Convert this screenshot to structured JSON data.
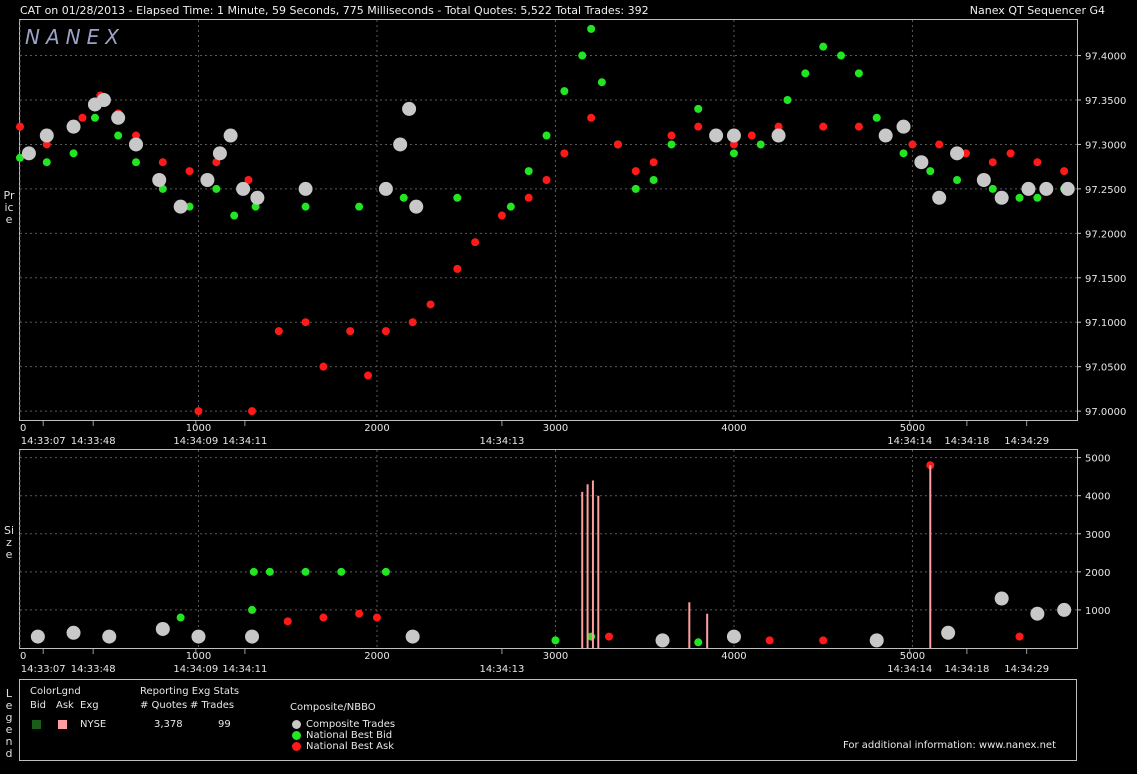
{
  "header": {
    "left": "CAT on 01/28/2013  -  Elapsed Time: 1 Minute, 59 Seconds, 775 Milliseconds  -  Total Quotes: 5,522  Total Trades: 392",
    "right": "Nanex QT Sequencer G4",
    "logo": "NANEX"
  },
  "side_labels": {
    "price": "Price",
    "size": "Size",
    "legend": "Legend"
  },
  "legend": {
    "colorlgnd_title": "ColorLgnd",
    "bid_label": "Bid",
    "ask_label": "Ask",
    "exg_label": "Exg",
    "exchange": "NYSE",
    "bid_color": "#1a5c1a",
    "ask_color": "#ff9e9e",
    "stats_title": "Reporting Exg Stats",
    "quotes_label": "# Quotes",
    "trades_label": "# Trades",
    "quotes_value": "3,378",
    "trades_value": "99",
    "composite_title": "Composite/NBBO",
    "items": [
      {
        "label": "Composite Trades",
        "color": "#c8c8c8"
      },
      {
        "label": "National Best Bid",
        "color": "#22e622"
      },
      {
        "label": "National Best Ask",
        "color": "#ff1a1a"
      }
    ],
    "footer": "For additional information: www.nanex.net"
  },
  "chart_data": [
    {
      "type": "scatter",
      "ylabel": "Price",
      "xlim": [
        0,
        5922
      ],
      "ylim": [
        96.99,
        97.44
      ],
      "x_ticks": [
        0,
        1000,
        2000,
        3000,
        4000,
        5000
      ],
      "y_ticks": [
        "97.0000",
        "97.0500",
        "97.1000",
        "97.1500",
        "97.2000",
        "97.2500",
        "97.3000",
        "97.3500",
        "97.4000"
      ],
      "time_labels": [
        {
          "x": 130,
          "label": "14:33:07"
        },
        {
          "x": 410,
          "label": "14:33:48"
        },
        {
          "x": 985,
          "label": "14:34:09"
        },
        {
          "x": 1260,
          "label": "14:34:11"
        },
        {
          "x": 2700,
          "label": "14:34:13"
        },
        {
          "x": 4985,
          "label": "14:34:14"
        },
        {
          "x": 5305,
          "label": "14:34:18"
        },
        {
          "x": 5640,
          "label": "14:34:29"
        }
      ],
      "grid": true,
      "series": [
        {
          "name": "National Best Bid",
          "color": "#22e622",
          "points": [
            [
              0,
              97.285
            ],
            [
              150,
              97.28
            ],
            [
              300,
              97.29
            ],
            [
              420,
              97.33
            ],
            [
              550,
              97.31
            ],
            [
              650,
              97.28
            ],
            [
              800,
              97.25
            ],
            [
              950,
              97.23
            ],
            [
              1100,
              97.25
            ],
            [
              1200,
              97.22
            ],
            [
              1320,
              97.23
            ],
            [
              1600,
              97.23
            ],
            [
              1900,
              97.23
            ],
            [
              2150,
              97.24
            ],
            [
              2450,
              97.24
            ],
            [
              2750,
              97.23
            ],
            [
              2850,
              97.27
            ],
            [
              2950,
              97.31
            ],
            [
              3050,
              97.36
            ],
            [
              3150,
              97.4
            ],
            [
              3200,
              97.43
            ],
            [
              3260,
              97.37
            ],
            [
              3350,
              97.3
            ],
            [
              3450,
              97.25
            ],
            [
              3550,
              97.26
            ],
            [
              3650,
              97.3
            ],
            [
              3800,
              97.34
            ],
            [
              3900,
              97.31
            ],
            [
              4000,
              97.29
            ],
            [
              4150,
              97.3
            ],
            [
              4300,
              97.35
            ],
            [
              4400,
              97.38
            ],
            [
              4500,
              97.41
            ],
            [
              4600,
              97.4
            ],
            [
              4700,
              97.38
            ],
            [
              4800,
              97.33
            ],
            [
              4950,
              97.29
            ],
            [
              5100,
              97.27
            ],
            [
              5250,
              97.26
            ],
            [
              5450,
              97.25
            ],
            [
              5600,
              97.24
            ],
            [
              5700,
              97.24
            ],
            [
              5850,
              97.25
            ]
          ]
        },
        {
          "name": "National Best Ask",
          "color": "#ff1a1a",
          "points": [
            [
              0,
              97.32
            ],
            [
              150,
              97.3
            ],
            [
              350,
              97.33
            ],
            [
              450,
              97.355
            ],
            [
              550,
              97.335
            ],
            [
              650,
              97.31
            ],
            [
              800,
              97.28
            ],
            [
              950,
              97.27
            ],
            [
              1100,
              97.28
            ],
            [
              1280,
              97.26
            ],
            [
              1000,
              97.0
            ],
            [
              1300,
              97.0
            ],
            [
              1450,
              97.09
            ],
            [
              1600,
              97.1
            ],
            [
              1700,
              97.05
            ],
            [
              1850,
              97.09
            ],
            [
              1950,
              97.04
            ],
            [
              2050,
              97.09
            ],
            [
              2200,
              97.1
            ],
            [
              2300,
              97.12
            ],
            [
              2450,
              97.16
            ],
            [
              2550,
              97.19
            ],
            [
              2700,
              97.22
            ],
            [
              2850,
              97.24
            ],
            [
              2950,
              97.26
            ],
            [
              3050,
              97.29
            ],
            [
              3200,
              97.33
            ],
            [
              3350,
              97.3
            ],
            [
              3450,
              97.27
            ],
            [
              3550,
              97.28
            ],
            [
              3650,
              97.31
            ],
            [
              3800,
              97.32
            ],
            [
              3900,
              97.31
            ],
            [
              4000,
              97.3
            ],
            [
              4100,
              97.31
            ],
            [
              4250,
              97.32
            ],
            [
              4500,
              97.32
            ],
            [
              4700,
              97.32
            ],
            [
              4850,
              97.31
            ],
            [
              5000,
              97.3
            ],
            [
              5150,
              97.3
            ],
            [
              5300,
              97.29
            ],
            [
              5450,
              97.28
            ],
            [
              5550,
              97.29
            ],
            [
              5700,
              97.28
            ],
            [
              5850,
              97.27
            ]
          ]
        },
        {
          "name": "Composite Trades",
          "color": "#c8c8c8",
          "points": [
            [
              50,
              97.29
            ],
            [
              150,
              97.31
            ],
            [
              300,
              97.32
            ],
            [
              420,
              97.345
            ],
            [
              470,
              97.35
            ],
            [
              550,
              97.33
            ],
            [
              650,
              97.3
            ],
            [
              780,
              97.26
            ],
            [
              900,
              97.23
            ],
            [
              1050,
              97.26
            ],
            [
              1120,
              97.29
            ],
            [
              1180,
              97.31
            ],
            [
              1250,
              97.25
            ],
            [
              1330,
              97.24
            ],
            [
              1600,
              97.25
            ],
            [
              2050,
              97.25
            ],
            [
              2130,
              97.3
            ],
            [
              2180,
              97.34
            ],
            [
              2220,
              97.23
            ],
            [
              3900,
              97.31
            ],
            [
              4000,
              97.31
            ],
            [
              4250,
              97.31
            ],
            [
              4850,
              97.31
            ],
            [
              4950,
              97.32
            ],
            [
              5050,
              97.28
            ],
            [
              5150,
              97.24
            ],
            [
              5250,
              97.29
            ],
            [
              5400,
              97.26
            ],
            [
              5500,
              97.24
            ],
            [
              5650,
              97.25
            ],
            [
              5750,
              97.25
            ],
            [
              5870,
              97.25
            ]
          ]
        }
      ]
    },
    {
      "type": "scatter",
      "ylabel": "Size",
      "xlim": [
        0,
        5922
      ],
      "ylim": [
        0,
        5200
      ],
      "x_ticks": [
        0,
        1000,
        2000,
        3000,
        4000,
        5000
      ],
      "y_ticks": [
        1000,
        2000,
        3000,
        4000,
        5000
      ],
      "time_labels": [
        {
          "x": 130,
          "label": "14:33:07"
        },
        {
          "x": 410,
          "label": "14:33:48"
        },
        {
          "x": 985,
          "label": "14:34:09"
        },
        {
          "x": 1260,
          "label": "14:34:11"
        },
        {
          "x": 2700,
          "label": "14:34:13"
        },
        {
          "x": 4985,
          "label": "14:34:14"
        },
        {
          "x": 5305,
          "label": "14:34:18"
        },
        {
          "x": 5640,
          "label": "14:34:29"
        }
      ],
      "grid": true,
      "series": [
        {
          "name": "National Best Bid",
          "color": "#22e622",
          "points": [
            [
              1310,
              2000
            ],
            [
              1400,
              2000
            ],
            [
              1600,
              2000
            ],
            [
              1800,
              2000
            ],
            [
              2050,
              2000
            ],
            [
              1300,
              1000
            ],
            [
              900,
              800
            ],
            [
              3000,
              200
            ],
            [
              3200,
              300
            ],
            [
              3800,
              150
            ]
          ]
        },
        {
          "name": "National Best Ask",
          "color": "#ff1a1a",
          "points": [
            [
              1500,
              700
            ],
            [
              1700,
              800
            ],
            [
              1900,
              900
            ],
            [
              2000,
              800
            ],
            [
              2200,
              300
            ],
            [
              3300,
              300
            ],
            [
              4200,
              200
            ],
            [
              4500,
              200
            ],
            [
              5100,
              4800
            ],
            [
              5600,
              300
            ]
          ]
        },
        {
          "name": "Composite Trades",
          "color": "#c8c8c8",
          "points": [
            [
              100,
              300
            ],
            [
              300,
              400
            ],
            [
              500,
              300
            ],
            [
              800,
              500
            ],
            [
              1000,
              300
            ],
            [
              1300,
              300
            ],
            [
              2200,
              300
            ],
            [
              3600,
              200
            ],
            [
              4000,
              300
            ],
            [
              4800,
              200
            ],
            [
              5200,
              400
            ],
            [
              5500,
              1300
            ],
            [
              5700,
              900
            ],
            [
              5850,
              1000
            ]
          ]
        },
        {
          "name": "NYSE Ask spikes",
          "color": "#ff9e9e",
          "points": [
            [
              3150,
              4100
            ],
            [
              3180,
              4300
            ],
            [
              3210,
              4400
            ],
            [
              3240,
              4000
            ],
            [
              3750,
              1200
            ],
            [
              3850,
              900
            ],
            [
              5100,
              4800
            ]
          ]
        }
      ]
    }
  ]
}
